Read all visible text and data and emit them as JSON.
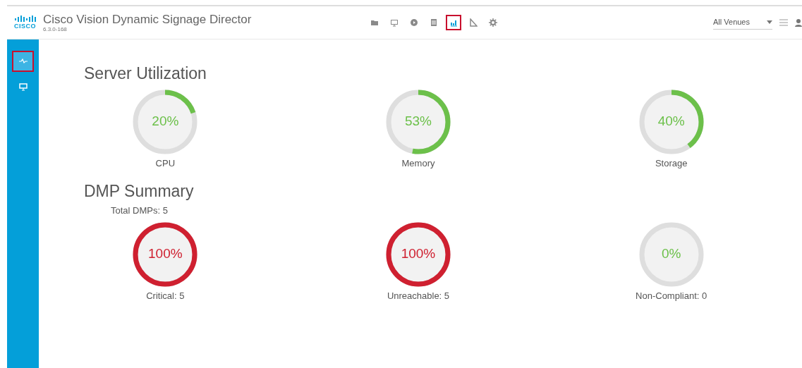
{
  "header": {
    "logo_text": "CISCO",
    "title": "Cisco Vision Dynamic Signage Director",
    "version": "6.3.0-168",
    "toolbar": [
      {
        "kind": "folder",
        "selected": false
      },
      {
        "kind": "monitor",
        "selected": false
      },
      {
        "kind": "play",
        "selected": false
      },
      {
        "kind": "list",
        "selected": false
      },
      {
        "kind": "chart",
        "selected": true
      },
      {
        "kind": "triangle",
        "selected": false
      },
      {
        "kind": "gear",
        "selected": false
      }
    ],
    "venue_select": {
      "value": "All Venues"
    }
  },
  "sidebar": {
    "items": [
      {
        "kind": "pulse",
        "selected": true
      },
      {
        "kind": "monitor",
        "selected": false
      }
    ]
  },
  "server_utilization": {
    "title": "Server Utilization",
    "gauges": [
      {
        "value": "20%",
        "label": "CPU",
        "level": 0.2,
        "color": "#6cc04a"
      },
      {
        "value": "53%",
        "label": "Memory",
        "level": 0.53,
        "color": "#6cc04a"
      },
      {
        "value": "40%",
        "label": "Storage",
        "level": 0.4,
        "color": "#6cc04a"
      }
    ]
  },
  "dmp_summary": {
    "title": "DMP Summary",
    "total": "Total DMPs: 5",
    "gauges": [
      {
        "value": "100%",
        "label": "Critical: 5",
        "level": 1,
        "color": "#cf2030"
      },
      {
        "value": "100%",
        "label": "Unreachable: 5",
        "level": 1,
        "color": "#cf2030"
      },
      {
        "value": "0%",
        "label": "Non-Compliant: 0",
        "level": 0,
        "color": "#6cc04a"
      }
    ]
  }
}
